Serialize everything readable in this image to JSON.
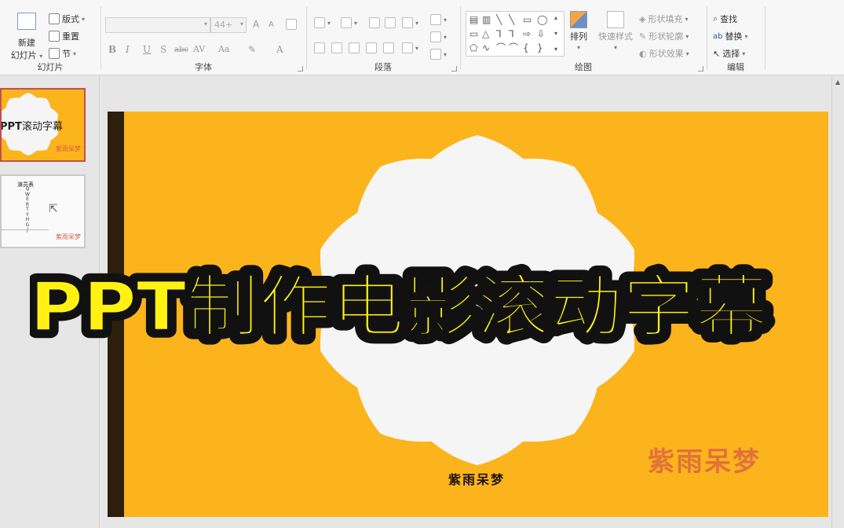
{
  "ribbon": {
    "slides_group": {
      "label": "幻灯片",
      "new_slide_line1": "新建",
      "new_slide_line2": "幻灯片",
      "layout": "版式",
      "reset": "重置",
      "section": "节"
    },
    "font_group": {
      "label": "字体",
      "font_name": "",
      "font_size": "44+",
      "grow": "A",
      "shrink": "A",
      "bold": "B",
      "italic": "I",
      "underline": "U",
      "shadow": "S",
      "strike": "abc",
      "spacing": "AV",
      "case": "Aa",
      "color": "A"
    },
    "paragraph_group": {
      "label": "段落"
    },
    "drawing_group": {
      "label": "绘图",
      "arrange": "排列",
      "quick_styles": "快速样式",
      "shape_fill": "形状填充",
      "shape_outline": "形状轮廓",
      "shape_effects": "形状效果"
    },
    "editing_group": {
      "label": "编辑",
      "find": "查找",
      "replace": "替换",
      "select": "选择"
    }
  },
  "thumbnails": [
    {
      "number": "1",
      "title_bold": "PPT",
      "title_rest": "滚动字幕",
      "author": "紫雨呆梦"
    },
    {
      "number": "2",
      "author": "紫雨呆梦",
      "list_header": "演员表",
      "list_items": [
        "Q",
        "W",
        "E",
        "R",
        "T",
        "Y",
        "H",
        "G",
        "J"
      ]
    }
  ],
  "slide": {
    "author": "紫雨呆梦",
    "watermark": "紫雨呆梦"
  },
  "overlay_title": "PPT制作电影滚动字幕",
  "colors": {
    "slide_bg": "#fcb41c",
    "slide_bar": "#2d1f0c",
    "badge_fill": "#f5f5f5",
    "title_fill": "#fff212",
    "title_stroke": "#111111",
    "watermark": "#d85d44"
  }
}
